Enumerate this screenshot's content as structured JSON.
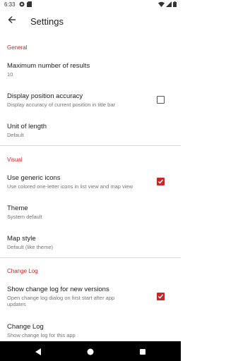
{
  "status": {
    "time": "6:33"
  },
  "appbar": {
    "title": "Settings"
  },
  "sections": {
    "general": "General",
    "visual": "Visual",
    "changelog": "Change Log"
  },
  "items": {
    "max_results": {
      "label": "Maximum number of results",
      "sub": "10"
    },
    "position_accuracy": {
      "label": "Display position accuracy",
      "sub": "Display accuracy of current position in title bar",
      "checked": false
    },
    "unit_length": {
      "label": "Unit of length",
      "sub": "Default"
    },
    "generic_icons": {
      "label": "Use generic icons",
      "sub": "Use colored one-letter icons in list view and map view",
      "checked": true
    },
    "theme": {
      "label": "Theme",
      "sub": "System default"
    },
    "map_style": {
      "label": "Map style",
      "sub": "Default (like theme)"
    },
    "show_changelog": {
      "label": "Show change log for new versions",
      "sub": "Open change log dialog on first start after app updates",
      "checked": true
    },
    "changelog": {
      "label": "Change Log",
      "sub": "Show change log for this app"
    }
  },
  "colors": {
    "accent": "#c62828",
    "navbar": "#000000"
  }
}
